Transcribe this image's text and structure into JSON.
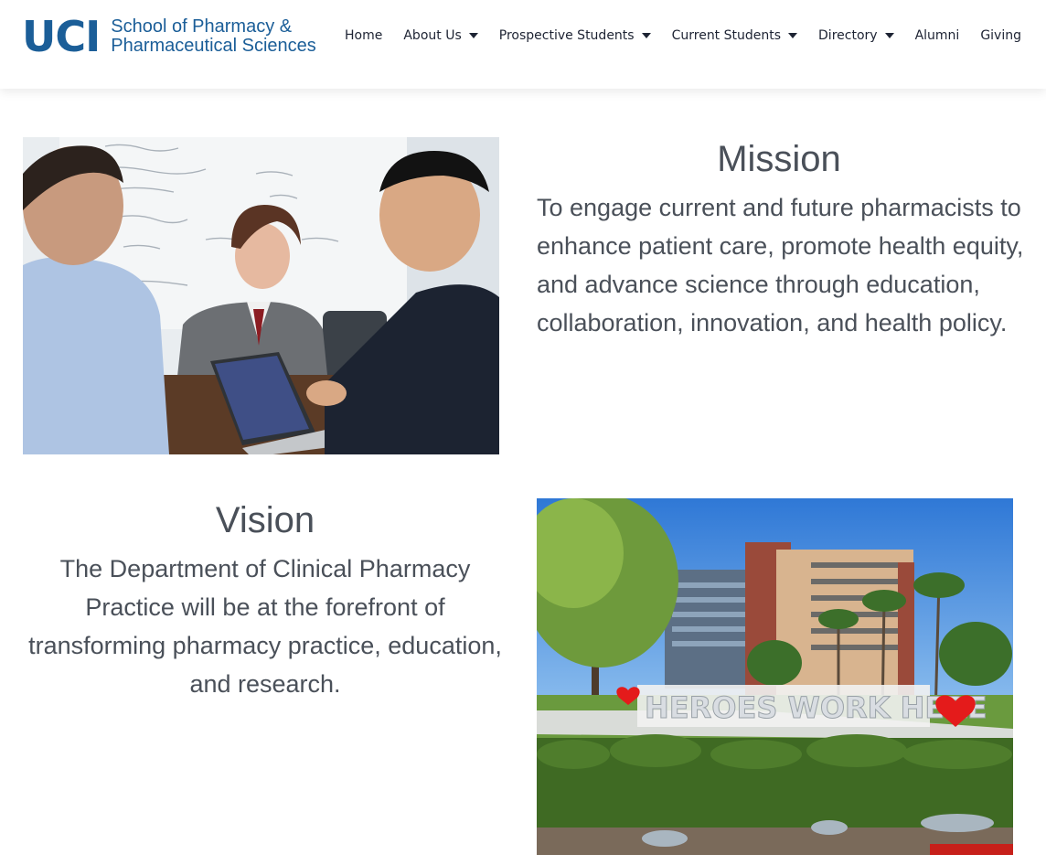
{
  "header": {
    "logo_mark": "UCI",
    "logo_line1": "School of Pharmacy &",
    "logo_line2": "Pharmaceutical Sciences",
    "brand_color": "#1b5e98",
    "nav": [
      {
        "label": "Home",
        "dropdown": false
      },
      {
        "label": "About Us",
        "dropdown": true
      },
      {
        "label": "Prospective Students",
        "dropdown": true
      },
      {
        "label": "Current Students",
        "dropdown": true
      },
      {
        "label": "Directory",
        "dropdown": true
      },
      {
        "label": "Alumni",
        "dropdown": false
      },
      {
        "label": "Giving",
        "dropdown": false
      }
    ]
  },
  "mission": {
    "title": "Mission",
    "text": "To engage current and future pharmacists to enhance patient care, promote health equity, and advance science through education, collaboration, innovation, and health policy."
  },
  "vision": {
    "title": "Vision",
    "text": "The Department of Clinical Pharmacy Practice will be at the forefront of transforming pharmacy practice, education, and research.",
    "sign_text": "HEROES WORK HERE"
  },
  "colors": {
    "text": "#4a5059",
    "nav_text": "#1d2333"
  }
}
